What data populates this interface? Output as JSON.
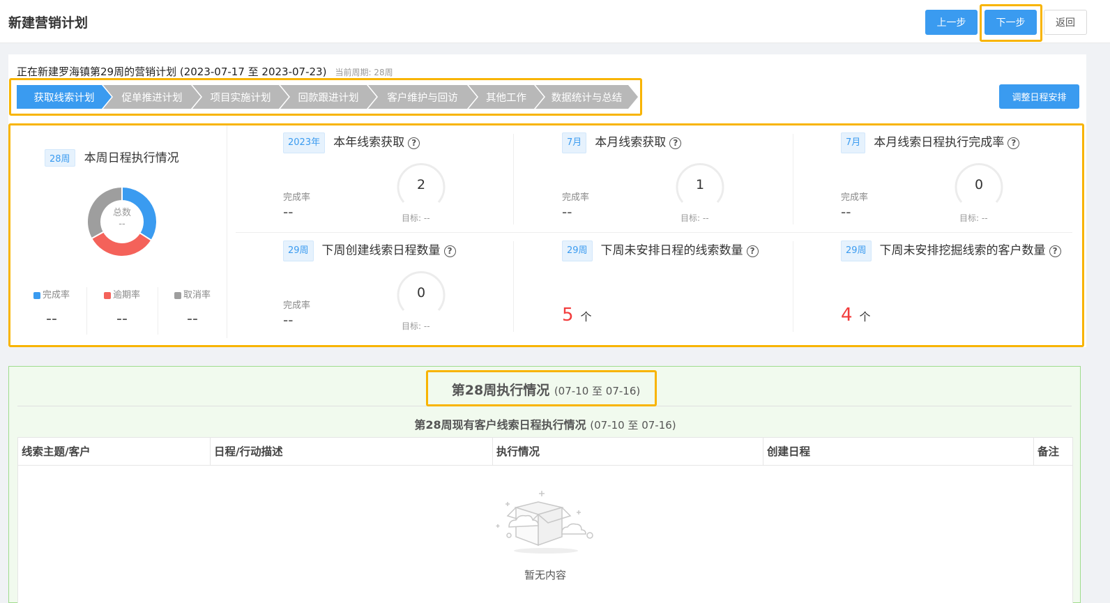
{
  "header": {
    "title": "新建营销计划",
    "prev_label": "上一步",
    "next_label": "下一步",
    "back_label": "返回"
  },
  "plan": {
    "title": "正在新建罗海镇第29周的营销计划 (2023-07-17 至 2023-07-23)",
    "current_period": "当前周期: 28周",
    "adjust_button": "调整日程安排",
    "steps": [
      {
        "label": "获取线索计划",
        "active": true
      },
      {
        "label": "促单推进计划",
        "active": false
      },
      {
        "label": "项目实施计划",
        "active": false
      },
      {
        "label": "回款跟进计划",
        "active": false
      },
      {
        "label": "客户维护与回访",
        "active": false
      },
      {
        "label": "其他工作",
        "active": false
      },
      {
        "label": "数据统计与总结",
        "active": false
      }
    ]
  },
  "week_card": {
    "tag": "28周",
    "title": "本周日程执行情况",
    "donut_label": "总数",
    "donut_value": "--",
    "donut_segments": [
      {
        "name": "完成率",
        "fraction": 0.34,
        "color": "#3a9bf0"
      },
      {
        "name": "逾期率",
        "fraction": 0.33,
        "color": "#f4625a"
      },
      {
        "name": "取消率",
        "fraction": 0.33,
        "color": "#9e9e9e"
      }
    ],
    "legend": [
      {
        "label": "完成率",
        "value": "--",
        "color": "#3a9bf0"
      },
      {
        "label": "逾期率",
        "value": "--",
        "color": "#f4625a"
      },
      {
        "label": "取消率",
        "value": "--",
        "color": "#9e9e9e"
      }
    ]
  },
  "metrics": [
    {
      "tag": "2023年",
      "title": "本年线索获取",
      "rate_label": "完成率",
      "rate_value": "--",
      "gauge_value": "2",
      "goal": "目标:  --"
    },
    {
      "tag": "7月",
      "title": "本月线索获取",
      "rate_label": "完成率",
      "rate_value": "--",
      "gauge_value": "1",
      "goal": "目标:  --"
    },
    {
      "tag": "7月",
      "title": "本月线索日程执行完成率",
      "rate_label": "完成率",
      "rate_value": "--",
      "gauge_value": "0",
      "goal": "目标:  --"
    },
    {
      "tag": "29周",
      "title": "下周创建线索日程数量",
      "rate_label": "完成率",
      "rate_value": "--",
      "gauge_value": "0",
      "goal": "目标:  --"
    },
    {
      "tag": "29周",
      "title": "下周未安排日程的线索数量",
      "count": "5",
      "unit": "个"
    },
    {
      "tag": "29周",
      "title": "下周未安排挖掘线索的客户数量",
      "count": "4",
      "unit": "个"
    }
  ],
  "execution": {
    "title": "第28周执行情况",
    "range": "(07-10 至 07-16)",
    "subtitle": "第28周现有客户线索日程执行情况",
    "subtitle_range": "(07-10 至 07-16)",
    "columns": [
      "线索主题/客户",
      "日程/行动描述",
      "执行情况",
      "创建日程",
      "备注"
    ],
    "empty_text": "暂无内容"
  },
  "colors": {
    "primary": "#3a9bf0",
    "highlight": "#f8b400",
    "danger": "#f23c3c",
    "step_inactive": "#b8b8b8"
  }
}
